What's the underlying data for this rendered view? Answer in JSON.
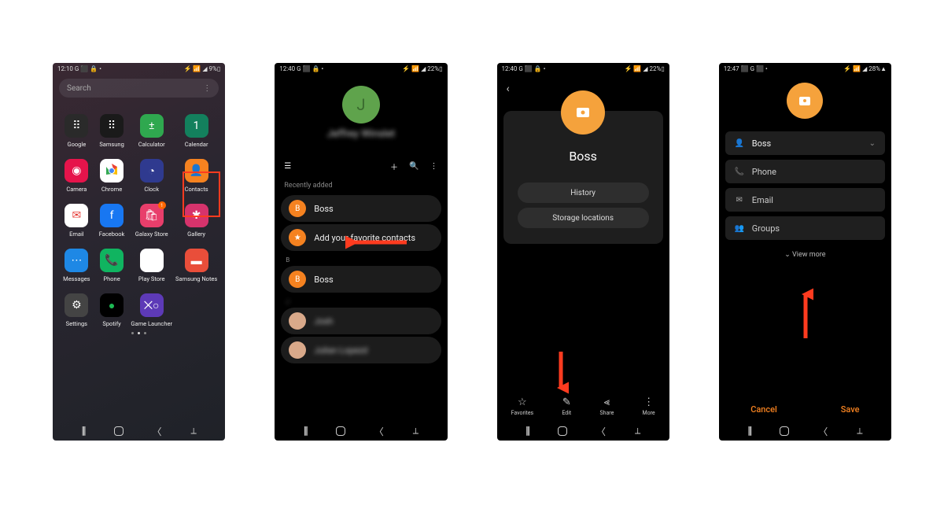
{
  "phone1": {
    "status": {
      "left": "12:10 G ⬛ 🔒 •",
      "right": "⚡ 📶 ◢ 9%▯"
    },
    "search_placeholder": "Search",
    "apps": [
      {
        "label": "Google",
        "icon": "google"
      },
      {
        "label": "Samsung",
        "icon": "samsung"
      },
      {
        "label": "Calculator",
        "icon": "calc"
      },
      {
        "label": "Calendar",
        "icon": "cal"
      },
      {
        "label": "Camera",
        "icon": "camera"
      },
      {
        "label": "Chrome",
        "icon": "chrome"
      },
      {
        "label": "Clock",
        "icon": "clock"
      },
      {
        "label": "Contacts",
        "icon": "contacts"
      },
      {
        "label": "Email",
        "icon": "email"
      },
      {
        "label": "Facebook",
        "icon": "fb"
      },
      {
        "label": "Galaxy Store",
        "icon": "gstore",
        "badge": "1"
      },
      {
        "label": "Gallery",
        "icon": "gallery"
      },
      {
        "label": "Messages",
        "icon": "msg"
      },
      {
        "label": "Phone",
        "icon": "phone"
      },
      {
        "label": "Play Store",
        "icon": "pstore"
      },
      {
        "label": "Samsung Notes",
        "icon": "notes"
      },
      {
        "label": "Settings",
        "icon": "settings"
      },
      {
        "label": "Spotify",
        "icon": "spotify"
      },
      {
        "label": "Game Launcher",
        "icon": "launcher"
      }
    ],
    "highlight_index": 7
  },
  "phone2": {
    "status": {
      "left": "12:40 G ⬛ 🔒 •",
      "right": "⚡ 📶 ◢ 22%▯"
    },
    "profile_name": "Jeffrey Winslet",
    "recently_added_label": "Recently added",
    "items": {
      "recent": "Boss",
      "favorite_prompt": "Add your favorite contacts",
      "letter": "B",
      "contact_b": "Boss"
    }
  },
  "phone3": {
    "status": {
      "left": "12:40 G ⬛ 🔒 •",
      "right": "⚡ 📶 ◢ 22%▯"
    },
    "name": "Boss",
    "history_label": "History",
    "storage_label": "Storage locations",
    "actions": {
      "favorites": "Favorites",
      "edit": "Edit",
      "share": "Share",
      "more": "More"
    }
  },
  "phone4": {
    "status": {
      "left": "12:47 ⬛ G ⬛ •",
      "right": "⚡ 📶 ◢ 28%▲"
    },
    "fields": {
      "name_value": "Boss",
      "phone_label": "Phone",
      "email_label": "Email",
      "groups_label": "Groups"
    },
    "view_more": "View more",
    "cancel": "Cancel",
    "save": "Save"
  }
}
